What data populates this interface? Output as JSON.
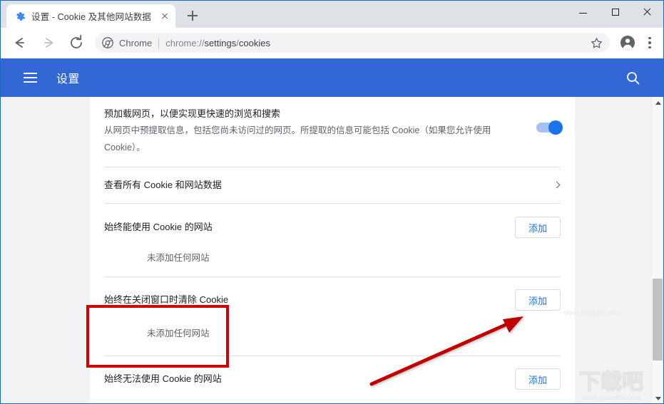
{
  "browser": {
    "tab": {
      "title": "设置 - Cookie 及其他网站数据",
      "favicon": "gear-icon",
      "close_label": "×"
    },
    "newtab_label": "+",
    "window_controls": {
      "minimize": "—",
      "maximize": "□",
      "close": "✕"
    },
    "toolbar": {
      "back": "←",
      "forward": "→",
      "reload": "⟳",
      "omnibox": {
        "scheme_label": "Chrome",
        "separator": "|",
        "url_prefix": "chrome://",
        "url_path_1": "settings",
        "url_slash": "/",
        "url_path_2": "cookies",
        "full_url": "chrome://settings/cookies"
      },
      "bookmark": "star-icon",
      "profile": "avatar-icon",
      "menu": "more-vertical-icon"
    }
  },
  "settings_header": {
    "menu_icon": "hamburger-icon",
    "title": "设置",
    "search_icon": "search-icon"
  },
  "content": {
    "preload": {
      "title": "预加载网页，以便实现更快速的浏览和搜索",
      "description_line1": "从网页中预提取信息，包括您尚未访问过的网页。所提取的信息可能包括 Cookie（如果您允许使用",
      "description_line2": "Cookie）。",
      "toggle_state": "on"
    },
    "view_all": {
      "label": "查看所有 Cookie 和网站数据",
      "chevron": "chevron-right-icon"
    },
    "sections": [
      {
        "title": "始终能使用 Cookie 的网站",
        "empty_text": "未添加任何网站",
        "add_label": "添加",
        "highlighted": true
      },
      {
        "title": "始终在关闭窗口时清除 Cookie",
        "empty_text": "未添加任何网站",
        "add_label": "添加",
        "highlighted": false
      },
      {
        "title": "始终无法使用 Cookie 的网站",
        "empty_text": "",
        "add_label": "添加",
        "highlighted": false
      }
    ]
  },
  "annotations": {
    "highlight_color": "#d00000",
    "arrow_color": "#c00000",
    "arrow_from": "520,403",
    "arrow_to": "730,308"
  },
  "watermark": {
    "logo_text": "下载吧",
    "site": "www.xiazaiba.com"
  },
  "theme": {
    "header_blue": "#3367d6",
    "accent_blue": "#1a73e8",
    "tabstrip_gray": "#dee1e6",
    "page_gray": "#f1f3f4"
  }
}
